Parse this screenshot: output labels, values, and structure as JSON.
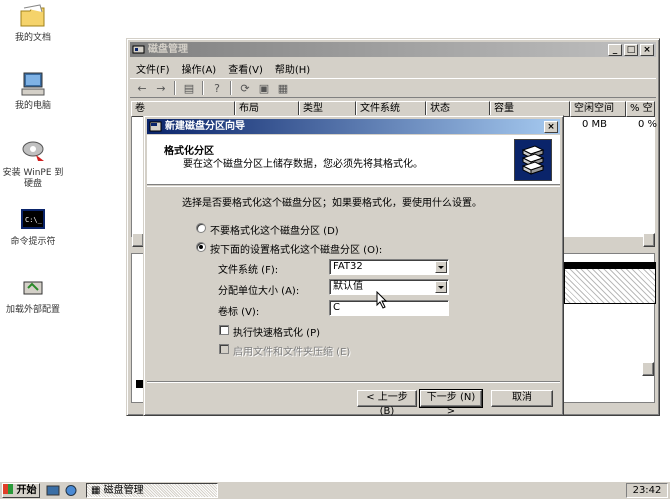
{
  "desktop": {
    "icons": [
      {
        "name": "my-documents",
        "label": "我的文档"
      },
      {
        "name": "my-computer",
        "label": "我的电脑"
      },
      {
        "name": "install-winpe",
        "label": "安装 WinPE 到\n硬盘"
      },
      {
        "name": "cmd-prompt",
        "label": "命令提示符"
      },
      {
        "name": "load-ext-config",
        "label": "加载外部配置"
      }
    ]
  },
  "disk_window": {
    "title": "磁盘管理",
    "menu": [
      "文件(F)",
      "操作(A)",
      "查看(V)",
      "帮助(H)"
    ],
    "columns": [
      "卷",
      "布局",
      "类型",
      "文件系统",
      "状态",
      "容量",
      "空闲空间",
      "% 空"
    ],
    "row": {
      "free": "0 MB",
      "pct": "0 %"
    }
  },
  "wizard": {
    "title": "新建磁盘分区向导",
    "header_title": "格式化分区",
    "header_subtitle": "要在这个磁盘分区上储存数据，您必须先将其格式化。",
    "question": "选择是否要格式化这个磁盘分区；如果要格式化，要使用什么设置。",
    "radio_no_format": "不要格式化这个磁盘分区 (D)",
    "radio_format": "按下面的设置格式化这个磁盘分区 (O):",
    "fs_label": "文件系统 (F):",
    "fs_value": "FAT32",
    "alloc_label": "分配单位大小 (A):",
    "alloc_value": "默认值",
    "vol_label": "卷标 (V):",
    "vol_value": "C",
    "quick_format": "执行快速格式化 (P)",
    "compression": "启用文件和文件夹压缩 (E)",
    "back_button": "< 上一步 (B)",
    "next_button": "下一步 (N) >",
    "cancel_button": "取消"
  },
  "taskbar": {
    "start_label": "开始",
    "task_label": "磁盘管理",
    "clock": "23:42"
  }
}
